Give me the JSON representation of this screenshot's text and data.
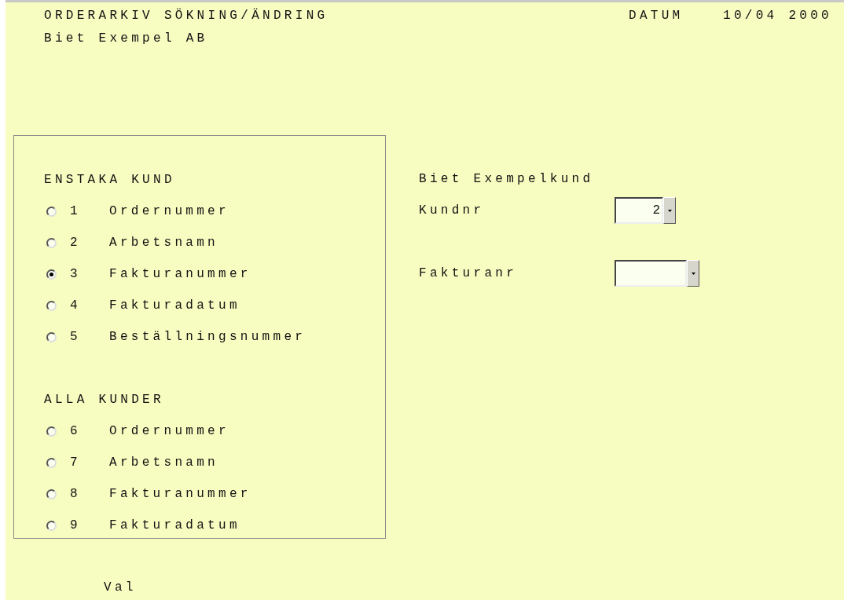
{
  "header": {
    "title": "ORDERARKIV SÖKNING/ÄNDRING",
    "company": "Biet Exempel AB",
    "date_label": "DATUM",
    "date": "10/04 2000"
  },
  "search_groups": [
    {
      "title": "ENSTAKA KUND",
      "options": [
        {
          "number": "1",
          "label": "Ordernummer",
          "selected": false
        },
        {
          "number": "2",
          "label": "Arbetsnamn",
          "selected": false
        },
        {
          "number": "3",
          "label": "Fakturanummer",
          "selected": true
        },
        {
          "number": "4",
          "label": "Fakturadatum",
          "selected": false
        },
        {
          "number": "5",
          "label": "Beställningsnummer",
          "selected": false
        }
      ]
    },
    {
      "title": "ALLA KUNDER",
      "options": [
        {
          "number": "6",
          "label": "Ordernummer",
          "selected": false
        },
        {
          "number": "7",
          "label": "Arbetsnamn",
          "selected": false
        },
        {
          "number": "8",
          "label": "Fakturanummer",
          "selected": false
        },
        {
          "number": "9",
          "label": "Fakturadatum",
          "selected": false
        }
      ]
    }
  ],
  "customer_name": "Biet Exempelkund",
  "fields": [
    {
      "label": "Kundnr",
      "value": "2"
    },
    {
      "label": "Fakturanr"
    }
  ],
  "footer_label": "Val"
}
